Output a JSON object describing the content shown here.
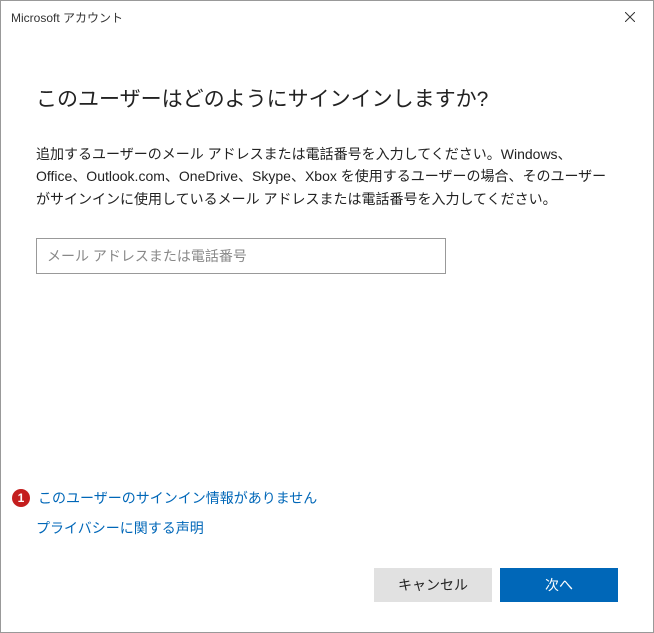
{
  "titlebar": {
    "title": "Microsoft アカウント"
  },
  "heading": "このユーザーはどのようにサインインしますか?",
  "description": "追加するユーザーのメール アドレスまたは電話番号を入力してください。Windows、Office、Outlook.com、OneDrive、Skype、Xbox を使用するユーザーの場合、そのユーザーがサインインに使用しているメール アドレスまたは電話番号を入力してください。",
  "input": {
    "placeholder": "メール アドレスまたは電話番号"
  },
  "links": {
    "bullet1": "1",
    "no_signin_info": "このユーザーのサインイン情報がありません",
    "privacy": "プライバシーに関する声明"
  },
  "buttons": {
    "cancel": "キャンセル",
    "next": "次へ"
  }
}
